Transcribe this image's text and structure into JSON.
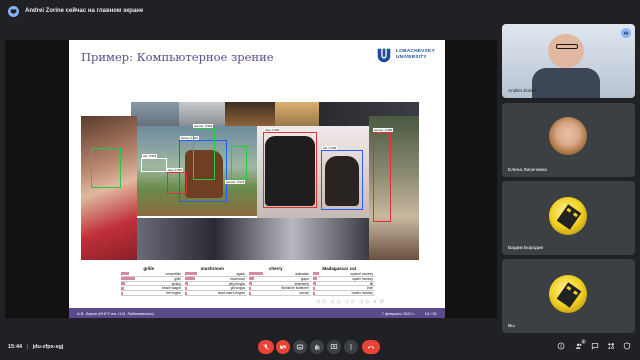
{
  "top_bar": {
    "notice": "Andrei Zorine сейчас на главном экране"
  },
  "slide": {
    "title": "Пример: Компьютерное зрение",
    "logo_line1": "LOBACHEVSKY",
    "logo_line2": "UNIVERSITY",
    "detections": [
      "car: 0.918",
      "horse: 0.993",
      "person: 0.993",
      "dog: 0.997",
      "person: 0.979",
      "dog: 0.994",
      "cat: 0.999",
      "person: 0.980"
    ],
    "categories": [
      "grille",
      "mushroom",
      "cherry",
      "Madagascar cat"
    ],
    "predictions": [
      [
        "convertible",
        "grille",
        "pickup",
        "beach wagon",
        "fire engine"
      ],
      [
        "agaric",
        "mushroom",
        "jelly fungus",
        "gill fungus",
        "dead-man's-fingers"
      ],
      [
        "dalmatian",
        "grape",
        "elderberry",
        "ffordshire bullterrier",
        "currant"
      ],
      [
        "squirrel monkey",
        "spider monkey",
        "titi",
        "indri",
        "howler monkey"
      ]
    ],
    "footer_left": "А.В. Зорин (ННГУ им. Н.И. Лобачевского)",
    "footer_date": "7 февраля 2022 г.",
    "footer_page": "13 / 51"
  },
  "participants": [
    {
      "name": "Andrei Zorine"
    },
    {
      "name": "Елена Лисичкина"
    },
    {
      "name": "Вадим Бородин"
    },
    {
      "name": "Вы"
    }
  ],
  "bottom_bar": {
    "time": "15:44",
    "meeting_code": "jdu-zfpx-sgj",
    "people_count": "4"
  },
  "colors": {
    "accent": "#8ab4f8",
    "hangup": "#ea4335",
    "slide_accent": "#5a4a8c",
    "logo_blue": "#1e4d9b"
  }
}
